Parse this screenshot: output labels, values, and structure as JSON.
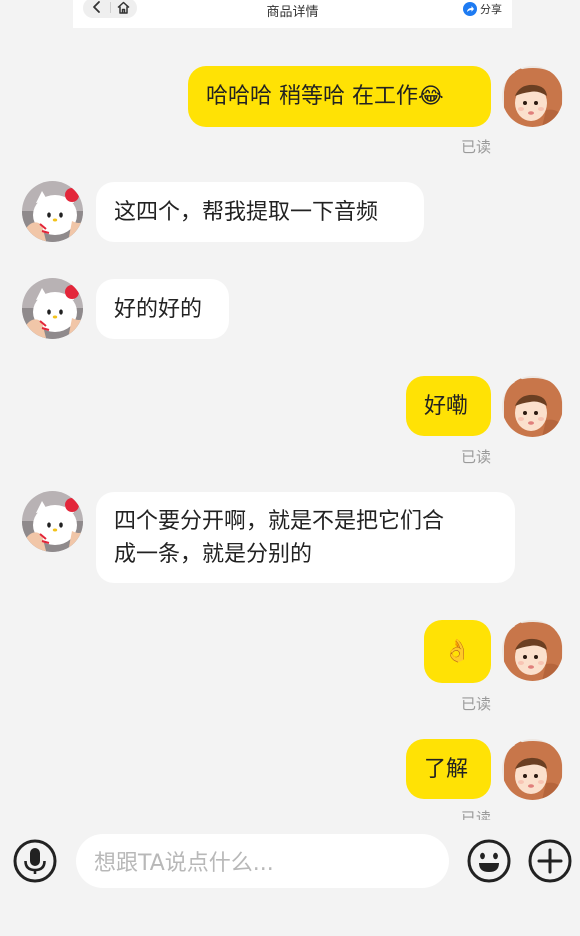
{
  "header": {
    "title": "商品详情",
    "share_label": "分享"
  },
  "messages": [
    {
      "side": "mine",
      "text": "哈哈哈 稍等哈 在工作😂",
      "status": "已读"
    },
    {
      "side": "theirs",
      "text": "这四个，帮我提取一下音频"
    },
    {
      "side": "theirs",
      "text": "好的好的"
    },
    {
      "side": "mine",
      "text": "好嘞",
      "status": "已读"
    },
    {
      "side": "theirs",
      "text_line1": "四个要分开啊，就是不是把它们合",
      "text_line2": "成一条，就是分别的"
    },
    {
      "side": "mine",
      "text": "👌",
      "status": "已读"
    },
    {
      "side": "mine",
      "text": "了解",
      "status": "已读"
    }
  ],
  "input": {
    "placeholder": "想跟TA说点什么..."
  },
  "colors": {
    "my_bubble": "#ffe205",
    "their_bubble": "#ffffff",
    "background": "#f3f3f3"
  },
  "icons": [
    "back-icon",
    "home-icon",
    "share-icon",
    "microphone-icon",
    "emoji-icon",
    "add-icon"
  ]
}
